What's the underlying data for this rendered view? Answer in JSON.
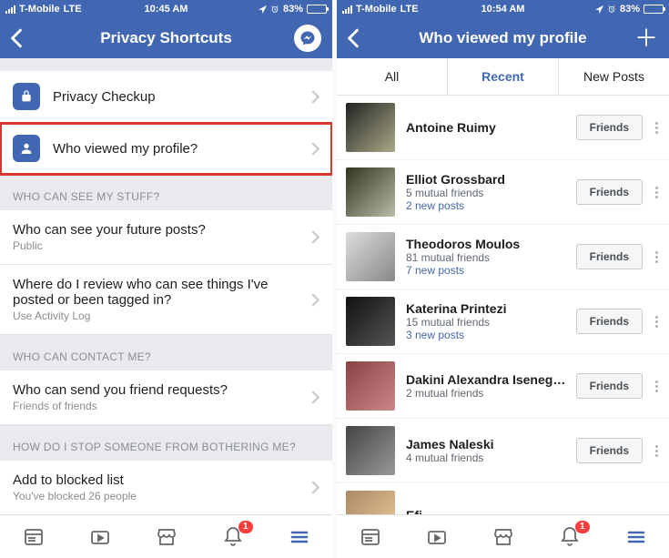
{
  "statusbar": {
    "carrier": "T-Mobile",
    "network": "LTE",
    "time_left": "10:45 AM",
    "time_right": "10:54 AM",
    "battery_pct": "83%"
  },
  "phone1": {
    "title": "Privacy Shortcuts",
    "rows": {
      "checkup": "Privacy Checkup",
      "viewed": "Who viewed my profile?"
    },
    "sections": {
      "s1": "WHO CAN SEE MY STUFF?",
      "s2": "WHO CAN CONTACT ME?",
      "s3": "HOW DO I STOP SOMEONE FROM BOTHERING ME?"
    },
    "q_future": "Who can see your future posts?",
    "q_future_sub": "Public",
    "q_review": "Where do I review who can see things I've posted or been tagged in?",
    "q_review_sub": "Use Activity Log",
    "q_friend": "Who can send you friend requests?",
    "q_friend_sub": "Friends of friends",
    "q_block": "Add to blocked list",
    "q_block_sub": "You've blocked 26 people",
    "badge": "1"
  },
  "phone2": {
    "title": "Who viewed my profile",
    "tabs": {
      "all": "All",
      "recent": "Recent",
      "newposts": "New Posts"
    },
    "friends_label": "Friends",
    "badge": "1",
    "people": [
      {
        "name": "Antoine Ruimy",
        "sub": "",
        "link": ""
      },
      {
        "name": "Elliot Grossbard",
        "sub": "5 mutual friends",
        "link": "2 new posts"
      },
      {
        "name": "Theodoros Moulos",
        "sub": "81 mutual friends",
        "link": "7 new posts"
      },
      {
        "name": "Katerina Printezi",
        "sub": "15 mutual friends",
        "link": "3 new posts"
      },
      {
        "name": "Dakini Alexandra Isenegger",
        "sub": "2 mutual friends",
        "link": ""
      },
      {
        "name": "James Naleski",
        "sub": "4 mutual friends",
        "link": ""
      },
      {
        "name": "Efi",
        "sub": "",
        "link": ""
      }
    ]
  }
}
